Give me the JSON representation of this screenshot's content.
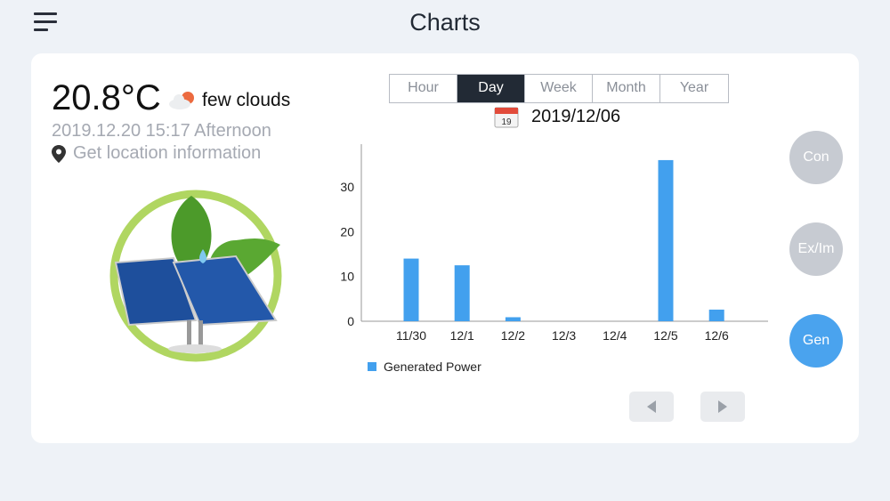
{
  "header": {
    "title": "Charts"
  },
  "weather": {
    "temperature": "20.8°C",
    "condition": "few clouds",
    "datetime": "2019.12.20 15:17 Afternoon",
    "location_link": "Get location information"
  },
  "tabs": [
    {
      "label": "Hour"
    },
    {
      "label": "Day",
      "active": true
    },
    {
      "label": "Week"
    },
    {
      "label": "Month"
    },
    {
      "label": "Year"
    }
  ],
  "calendar": {
    "icon_day": "19",
    "selected_date": "2019/12/06"
  },
  "side_buttons": [
    {
      "label": "Con"
    },
    {
      "label": "Ex/Im"
    },
    {
      "label": "Gen",
      "active": true
    }
  ],
  "colors": {
    "bar": "#42a0ee",
    "active_tab": "#222a35",
    "active_side": "#4aa3ee"
  },
  "chart_data": {
    "type": "bar",
    "categories": [
      "11/30",
      "12/1",
      "12/2",
      "12/3",
      "12/4",
      "12/5",
      "12/6"
    ],
    "series": [
      {
        "name": "Generated Power",
        "values": [
          14,
          12.5,
          0.9,
          0,
          0,
          36,
          2.6
        ]
      }
    ],
    "yticks": [
      0,
      10,
      20,
      30
    ],
    "ylim": [
      0,
      40
    ],
    "legend": "bottom-left"
  }
}
